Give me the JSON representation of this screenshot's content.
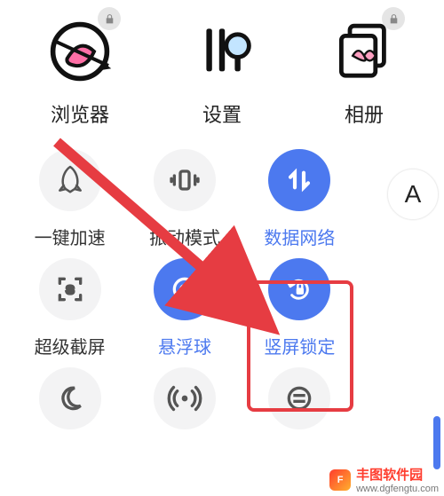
{
  "apps": {
    "browser": {
      "label": "浏览器",
      "locked": true
    },
    "settings": {
      "label": "设置",
      "locked": false
    },
    "gallery": {
      "label": "相册",
      "locked": true
    }
  },
  "quick_settings": {
    "row1": {
      "accel": {
        "label": "一键加速",
        "active": false
      },
      "vibrate": {
        "label": "振动模式",
        "active": false
      },
      "data": {
        "label": "数据网络",
        "active": true
      }
    },
    "row2": {
      "screenshot": {
        "label": "超级截屏",
        "active": false
      },
      "floatball": {
        "label": "悬浮球",
        "active": true
      },
      "portrait": {
        "label": "竖屏锁定",
        "active": true
      }
    }
  },
  "floating_button": {
    "label": "A"
  },
  "annotation": {
    "highlight_target": "quick_settings.row2.portrait",
    "arrow_from": "top-left",
    "arrow_to": "portrait-lock-tile"
  },
  "watermark": {
    "logo_letter": "F",
    "brand": "丰图软件园",
    "url": "www.dgfengtu.com"
  }
}
